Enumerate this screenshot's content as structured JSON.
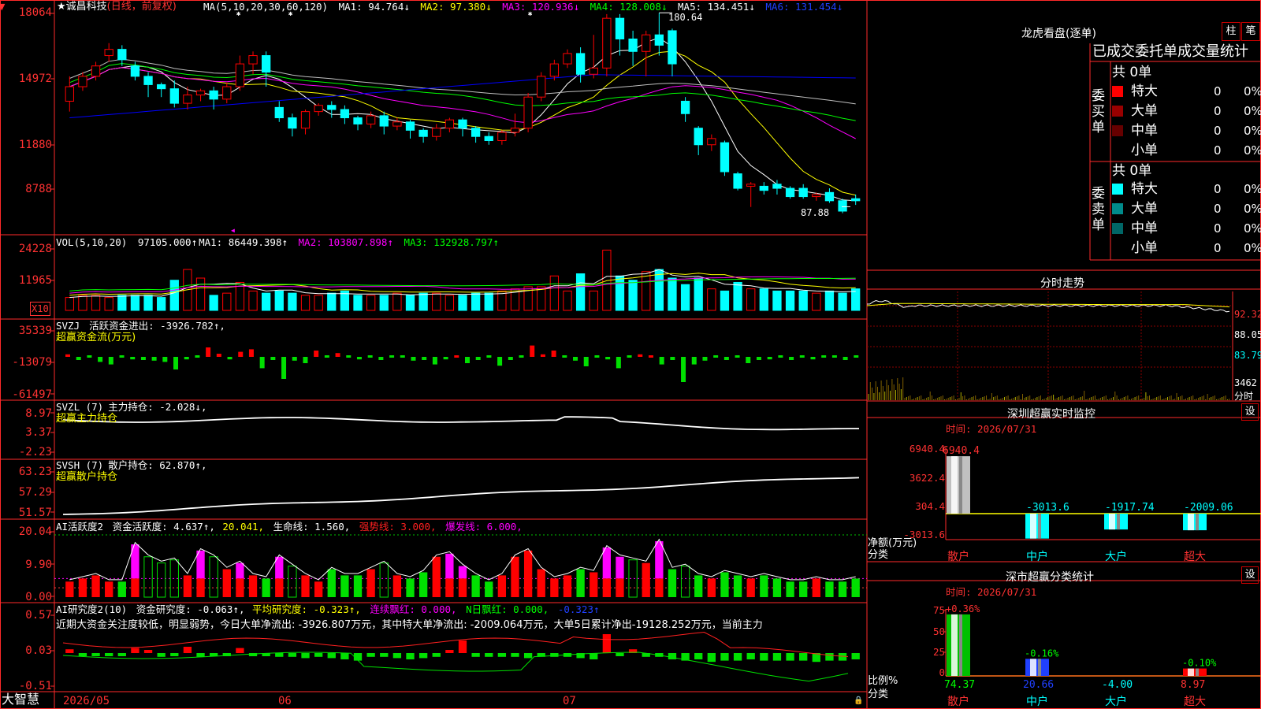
{
  "stock": {
    "star": "★",
    "name": "诚昌科技",
    "mode": "(日线，前复权)"
  },
  "ma_header": {
    "params": "MA(5,10,20,30,60,120)",
    "ma1": "MA1: 94.764↓",
    "ma2": "MA2: 97.380↓",
    "ma3": "MA3: 120.936↓",
    "ma4": "MA4: 128.008↓",
    "ma5": "MA5: 134.451↓",
    "ma6": "MA6: 131.454↓"
  },
  "price_axis": [
    "18064",
    "14972",
    "11880",
    "8788"
  ],
  "price_high_label": "180.64",
  "price_low_label": "87.88",
  "vol": {
    "params": "VOL(5,10,20)",
    "value": "97105.000↑",
    "ma1": "MA1: 86449.398↑",
    "ma2": "MA2: 103807.898↑",
    "ma3": "MA3: 132928.797↑",
    "axis": [
      "24228",
      "11965"
    ],
    "unit": "X10"
  },
  "svzj": {
    "params": "SVZJ",
    "title": "活跃资金进出: -3926.782↑,",
    "subtitle": "超赢资金流(万元)",
    "axis": [
      "35339",
      "-13079",
      "-61497"
    ]
  },
  "svzl": {
    "params": "SVZL (7)",
    "title": "主力持仓: -2.028↓,",
    "subtitle": "超赢主力持仓",
    "axis": [
      "8.97",
      "3.37",
      "-2.23"
    ]
  },
  "svsh": {
    "params": "SVSH (7)",
    "title": "散户持仓: 62.870↑,",
    "subtitle": "超赢散户持仓",
    "axis": [
      "63.23",
      "57.29",
      "51.57"
    ]
  },
  "ai1": {
    "params": "AI活跃度2",
    "title": "资金活跃度: 4.637↑,",
    "v2": "20.041,",
    "life": "生命线: 1.560,",
    "strong": "强势线: 3.000,",
    "burst": "爆发线: 6.000,",
    "axis": [
      "20.04",
      "9.90",
      "0.00"
    ]
  },
  "ai2": {
    "params": "AI研究度2(10)",
    "title": "资金研究度: -0.063↑,",
    "avg": "平均研究度: -0.323↑,",
    "red": "连续飘红: 0.000,",
    "nred": "N日飘红: 0.000,",
    "last": "-0.323↑",
    "text": "近期大资金关注度较低，明显弱势，今日大单净流出: -3926.807万元，其中特大单净流出: -2009.064万元，大单5日累计净出-19128.252万元，当前主力",
    "axis": [
      "0.57",
      "0.03",
      "-0.51"
    ]
  },
  "xaxis": {
    "app": "大智慧",
    "d1": "2026/05",
    "d2": "06",
    "d3": "07"
  },
  "right": {
    "lhkp": {
      "title": "龙虎看盘(逐单)",
      "btn1": "柱",
      "btn2": "笔",
      "header": "已成交委托单成交量统计",
      "buy_label": "委买单",
      "sell_label": "委卖单",
      "buy_total": "共 0单",
      "sell_total": "共 0单",
      "buy_rows": [
        {
          "name": "特大",
          "count": "0",
          "pct": "0%",
          "color": "#ff0000"
        },
        {
          "name": "大单",
          "count": "0",
          "pct": "0%",
          "color": "#990000"
        },
        {
          "name": "中单",
          "count": "0",
          "pct": "0%",
          "color": "#660000"
        },
        {
          "name": "小单",
          "count": "0",
          "pct": "0%",
          "color": ""
        }
      ],
      "sell_rows": [
        {
          "name": "特大",
          "count": "0",
          "pct": "0%",
          "color": "#00ffff"
        },
        {
          "name": "大单",
          "count": "0",
          "pct": "0%",
          "color": "#008b8b"
        },
        {
          "name": "中单",
          "count": "0",
          "pct": "0%",
          "color": "#006666"
        },
        {
          "name": "小单",
          "count": "0",
          "pct": "0%",
          "color": ""
        }
      ]
    },
    "fsz": {
      "title": "分时走势",
      "labels": [
        "92.32",
        "88.05",
        "83.79",
        "3462",
        "分时"
      ]
    },
    "szcy": {
      "title": "深圳超赢实时监控",
      "btn": "设",
      "time": "时间: 2026/07/31",
      "axis": [
        "6940.4",
        "3622.4",
        "304.4",
        "-3013.6"
      ],
      "y_label": "净额(万元)",
      "x_label": "分类",
      "cats": [
        "散户",
        "中户",
        "大户",
        "超大"
      ],
      "values": [
        6940.4,
        -3013.6,
        -1917.74,
        -2009.06
      ],
      "value_labels": [
        "6940.4",
        "-3013.6",
        "-1917.74",
        "-2009.06"
      ]
    },
    "scfl": {
      "title": "深市超赢分类统计",
      "btn": "设",
      "time": "时间: 2026/07/31",
      "axis": [
        "75",
        "50",
        "25",
        "0"
      ],
      "y_label": "比例%",
      "x_label": "分类",
      "cats": [
        "散户",
        "中户",
        "大户",
        "超大"
      ],
      "values": [
        74.37,
        20.66,
        -4.0,
        8.97
      ],
      "value_labels": [
        "74.37",
        "20.66",
        "-4.00",
        "8.97"
      ],
      "changes": [
        "+0.36%",
        "-0.16%",
        "",
        "-0.10%"
      ]
    }
  },
  "chart_data": [
    {
      "type": "candlestick",
      "title": "诚昌科技 (日线，前复权)",
      "ohlc": [
        [
          138,
          145,
          133,
          150
        ],
        [
          145,
          150,
          143,
          152
        ],
        [
          150,
          155,
          148,
          157
        ],
        [
          160,
          163,
          157,
          166
        ],
        [
          163,
          158,
          155,
          165
        ],
        [
          155,
          150,
          148,
          157
        ],
        [
          150,
          146,
          140,
          152
        ],
        [
          146,
          144,
          140,
          147
        ],
        [
          144,
          137,
          135,
          148
        ],
        [
          137,
          141,
          134,
          145
        ],
        [
          141,
          143,
          138,
          144
        ],
        [
          143,
          139,
          134,
          145
        ],
        [
          139,
          145,
          137,
          147
        ],
        [
          145,
          156,
          143,
          160
        ],
        [
          156,
          160,
          151,
          162
        ],
        [
          160,
          152,
          145,
          162
        ],
        [
          135,
          130,
          128,
          138
        ],
        [
          130,
          125,
          121,
          132
        ],
        [
          125,
          133,
          122,
          134
        ],
        [
          133,
          136,
          131,
          137
        ],
        [
          136,
          134,
          130,
          138
        ],
        [
          134,
          130,
          127,
          136
        ],
        [
          130,
          127,
          124,
          131
        ],
        [
          127,
          131,
          125,
          133
        ],
        [
          131,
          126,
          122,
          133
        ],
        [
          126,
          128,
          124,
          130
        ],
        [
          128,
          124,
          120,
          129
        ],
        [
          124,
          121,
          118,
          125
        ],
        [
          121,
          125,
          119,
          127
        ],
        [
          125,
          129,
          123,
          130
        ],
        [
          129,
          125,
          121,
          130
        ],
        [
          125,
          121,
          118,
          126
        ],
        [
          121,
          119,
          117,
          123
        ],
        [
          119,
          123,
          117,
          124
        ],
        [
          123,
          125,
          121,
          132
        ],
        [
          125,
          140,
          123,
          142
        ],
        [
          140,
          150,
          138,
          152
        ],
        [
          150,
          156,
          148,
          158
        ],
        [
          156,
          161,
          154,
          163
        ],
        [
          161,
          151,
          147,
          164
        ],
        [
          151,
          154,
          149,
          170
        ],
        [
          154,
          178,
          150,
          180
        ],
        [
          178,
          168,
          160,
          180
        ],
        [
          168,
          162,
          155,
          172
        ],
        [
          162,
          170,
          150,
          172
        ],
        [
          170,
          165,
          160,
          180.64
        ],
        [
          172,
          156,
          150,
          173
        ],
        [
          138,
          132,
          128,
          140
        ],
        [
          125,
          117,
          112,
          126
        ],
        [
          117,
          120,
          114,
          122
        ],
        [
          118,
          104,
          102,
          119
        ],
        [
          103,
          96,
          95,
          104
        ],
        [
          97,
          98,
          87,
          99
        ],
        [
          97,
          95,
          93,
          99
        ],
        [
          98,
          96,
          93,
          100
        ],
        [
          96,
          92,
          91,
          97
        ],
        [
          96,
          92,
          91,
          98
        ],
        [
          92,
          93,
          90,
          94
        ],
        [
          94,
          90,
          89,
          96
        ],
        [
          90,
          85,
          84,
          91
        ],
        [
          91,
          90,
          88,
          93
        ]
      ],
      "ma_series": [
        "MA1",
        "MA2",
        "MA3",
        "MA4",
        "MA5",
        "MA6"
      ],
      "ylim": [
        85,
        185
      ],
      "high": 180.64,
      "low": 87.88
    },
    {
      "type": "bar",
      "title": "VOL(5,10,20)",
      "values": [
        6,
        7,
        7,
        6,
        7,
        7,
        7,
        6,
        14,
        19,
        15,
        7,
        8,
        13,
        9,
        8,
        9,
        8,
        7,
        7,
        8,
        9,
        7,
        7,
        7,
        8,
        7,
        8,
        8,
        7,
        7,
        8,
        8,
        9,
        10,
        11,
        11,
        16,
        9,
        17,
        9,
        28,
        16,
        14,
        18,
        19,
        15,
        12,
        15,
        10,
        9,
        13,
        10,
        10,
        9,
        9,
        9,
        8,
        9,
        8,
        10
      ],
      "colors_up": "#ff0000",
      "colors_down": "#00ffff",
      "ylim": [
        0,
        24228
      ]
    },
    {
      "type": "bar",
      "title": "SVZJ 活跃资金进出",
      "ylim": [
        -61497,
        35339
      ],
      "values": [
        4,
        -5,
        -2,
        -8,
        -12,
        -3,
        -4,
        -5,
        -6,
        -8,
        -20,
        -4,
        -3,
        15,
        5,
        -4,
        8,
        12,
        -18,
        -5,
        -35,
        -6,
        -10,
        10,
        -3,
        6,
        -2,
        -4,
        -3,
        -5,
        -2,
        -3,
        -6,
        -5,
        -12,
        -4,
        2,
        -10,
        -5,
        -3,
        -14,
        -5,
        -3,
        18,
        4,
        10,
        -2,
        -6,
        -15,
        -3,
        -4,
        -18,
        -2,
        4,
        2,
        -12,
        -5,
        -40,
        -12,
        -6,
        -3,
        -5,
        -3,
        -10,
        -5,
        -4,
        -2,
        -5,
        -3,
        -4,
        -3,
        -2,
        -5,
        -3
      ]
    },
    {
      "type": "line",
      "title": "SVZL (7) 主力持仓",
      "ylim": [
        -2.23,
        8.97
      ]
    },
    {
      "type": "line",
      "title": "SVSH (7) 散户持仓",
      "ylim": [
        51.57,
        63.23
      ]
    },
    {
      "type": "bar",
      "title": "AI活跃度2 资金活跃度",
      "ylim": [
        0,
        20.04
      ],
      "values": [
        5,
        6,
        7,
        5,
        5,
        17,
        13,
        11,
        12,
        7,
        15,
        13,
        9,
        11,
        7,
        6,
        13,
        10,
        7,
        5,
        9,
        7,
        7,
        9,
        11,
        7,
        6,
        8,
        13,
        14,
        10,
        7,
        5,
        7,
        13,
        15,
        9,
        6,
        7,
        9,
        8,
        16,
        13,
        12,
        11,
        18,
        9,
        10,
        7,
        6,
        8,
        7,
        6,
        7,
        6,
        5,
        5,
        6,
        5,
        5,
        6
      ],
      "magenta_idx": [
        5,
        10,
        13,
        16,
        29,
        30,
        41,
        42,
        45
      ]
    },
    {
      "type": "bar",
      "title": "AI研究度2(10) 资金研究度",
      "ylim": [
        -0.51,
        0.57
      ],
      "values": []
    },
    {
      "type": "bar",
      "title": "深圳超赢实时监控",
      "categories": [
        "散户",
        "中户",
        "大户",
        "超大"
      ],
      "values": [
        6940.4,
        -3013.6,
        -1917.74,
        -2009.06
      ],
      "ylim": [
        -3013.6,
        6940.4
      ]
    },
    {
      "type": "bar",
      "title": "深市超赢分类统计",
      "categories": [
        "散户",
        "中户",
        "大户",
        "超大"
      ],
      "values": [
        74.37,
        20.66,
        -4.0,
        8.97
      ],
      "ylim": [
        0,
        75
      ]
    }
  ],
  "colors": {
    "up": "#ff0000",
    "down": "#00ffff",
    "ma1": "#ffffff",
    "ma2": "#ffff00",
    "ma3": "#ff00ff",
    "ma4": "#00ff00",
    "ma5": "#c0c0c0",
    "ma6": "#0000ff",
    "grid": "#a00000"
  }
}
